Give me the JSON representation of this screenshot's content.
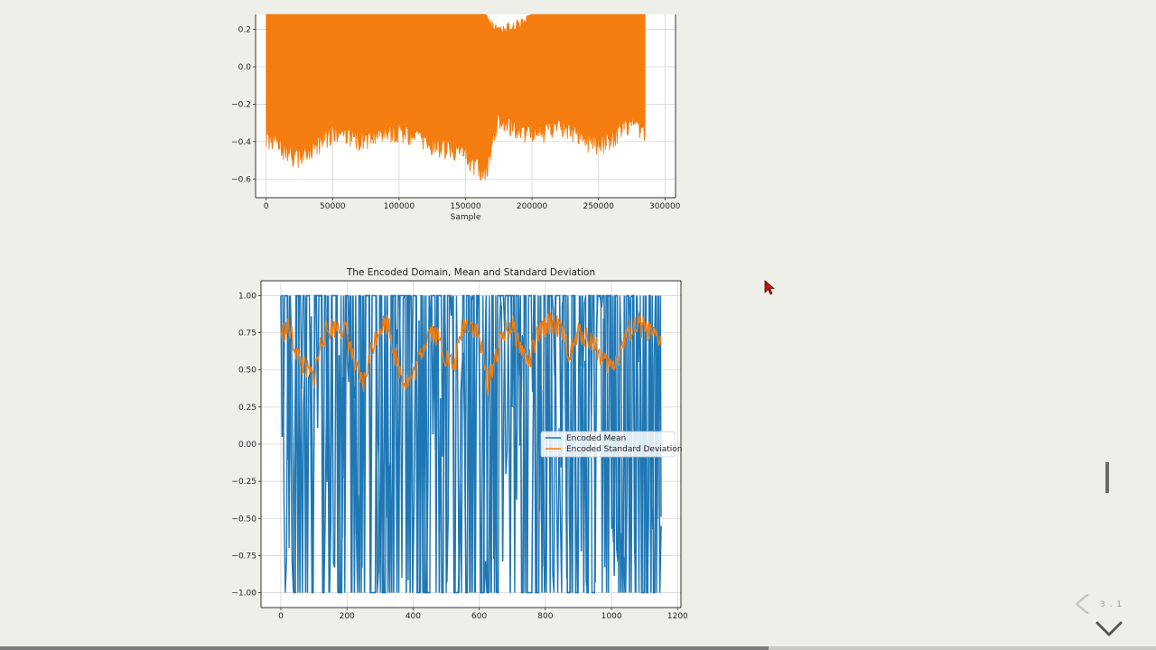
{
  "colors": {
    "mean": "#1f77b4",
    "std": "#f57c0e",
    "page_background": "#efefea",
    "plot_background": "#ffffff",
    "grid": "#d6d6d6",
    "control": "#666666"
  },
  "navigation": {
    "slide_number": "3 . 1",
    "left_icon": "chevron-left-icon",
    "down_icon": "chevron-down-icon",
    "progress": 0.665
  },
  "chart_data": [
    {
      "type": "line",
      "title": "",
      "xlabel": "Sample",
      "ylabel": "",
      "xlim": [
        -8000,
        308000
      ],
      "ylim": [
        -0.7,
        0.28
      ],
      "grid": true,
      "cropped_top": true,
      "xticks": [
        0,
        50000,
        100000,
        150000,
        200000,
        250000,
        300000
      ],
      "xtick_labels": [
        "0",
        "50000",
        "100000",
        "150000",
        "200000",
        "250000",
        "300000"
      ],
      "yticks": [
        0.2,
        0.0,
        -0.2,
        -0.4,
        -0.6
      ],
      "ytick_labels": [
        "0.2",
        "0.0",
        "−0.2",
        "−0.4",
        "−0.6"
      ],
      "series": [
        {
          "color": "#f57c0e",
          "x": [
            0,
            25000,
            50000,
            75000,
            100000,
            125000,
            150000,
            165000,
            175000,
            200000,
            225000,
            250000,
            275000,
            285000
          ],
          "max": [
            0.28,
            0.28,
            0.28,
            0.28,
            0.28,
            0.28,
            0.28,
            0.28,
            0.22,
            0.28,
            0.28,
            0.28,
            0.28,
            0.28
          ],
          "min": [
            -0.41,
            -0.52,
            -0.38,
            -0.43,
            -0.37,
            -0.45,
            -0.5,
            -0.61,
            -0.3,
            -0.4,
            -0.35,
            -0.46,
            -0.33,
            -0.4
          ]
        }
      ]
    },
    {
      "type": "line",
      "title": "The Encoded Domain, Mean and Standard Deviation",
      "xlabel": "",
      "ylabel": "",
      "xlim": [
        -60,
        1210
      ],
      "ylim": [
        -1.1,
        1.1
      ],
      "grid": true,
      "legend_position": "center-right",
      "xticks": [
        0,
        200,
        400,
        600,
        800,
        1000,
        1200
      ],
      "xtick_labels": [
        "0",
        "200",
        "400",
        "600",
        "800",
        "1000",
        "1200"
      ],
      "yticks": [
        1.0,
        0.75,
        0.5,
        0.25,
        0.0,
        -0.25,
        -0.5,
        -0.75,
        -1.0
      ],
      "ytick_labels": [
        "1.00",
        "0.75",
        "0.50",
        "0.25",
        "0.00",
        "−0.25",
        "−0.50",
        "−0.75",
        "−1.00"
      ],
      "series": [
        {
          "name": "Encoded Mean",
          "color": "#1f77b4",
          "x_range": [
            0,
            1150
          ],
          "range": [
            -1.0,
            1.0
          ]
        },
        {
          "name": "Encoded Standard Deviation",
          "color": "#f57c0e",
          "x": [
            0,
            25,
            50,
            75,
            100,
            125,
            150,
            175,
            200,
            225,
            250,
            275,
            300,
            325,
            350,
            375,
            400,
            425,
            450,
            475,
            500,
            525,
            550,
            575,
            600,
            625,
            650,
            675,
            700,
            725,
            750,
            775,
            800,
            825,
            850,
            875,
            900,
            925,
            950,
            975,
            1000,
            1025,
            1050,
            1075,
            1100,
            1125,
            1150
          ],
          "y": [
            0.75,
            0.78,
            0.6,
            0.5,
            0.45,
            0.72,
            0.78,
            0.8,
            0.75,
            0.5,
            0.4,
            0.65,
            0.8,
            0.82,
            0.55,
            0.42,
            0.45,
            0.62,
            0.78,
            0.72,
            0.58,
            0.52,
            0.8,
            0.82,
            0.72,
            0.4,
            0.6,
            0.75,
            0.8,
            0.65,
            0.55,
            0.72,
            0.8,
            0.82,
            0.75,
            0.6,
            0.75,
            0.72,
            0.68,
            0.55,
            0.52,
            0.62,
            0.75,
            0.8,
            0.78,
            0.72,
            0.7
          ]
        }
      ]
    }
  ]
}
